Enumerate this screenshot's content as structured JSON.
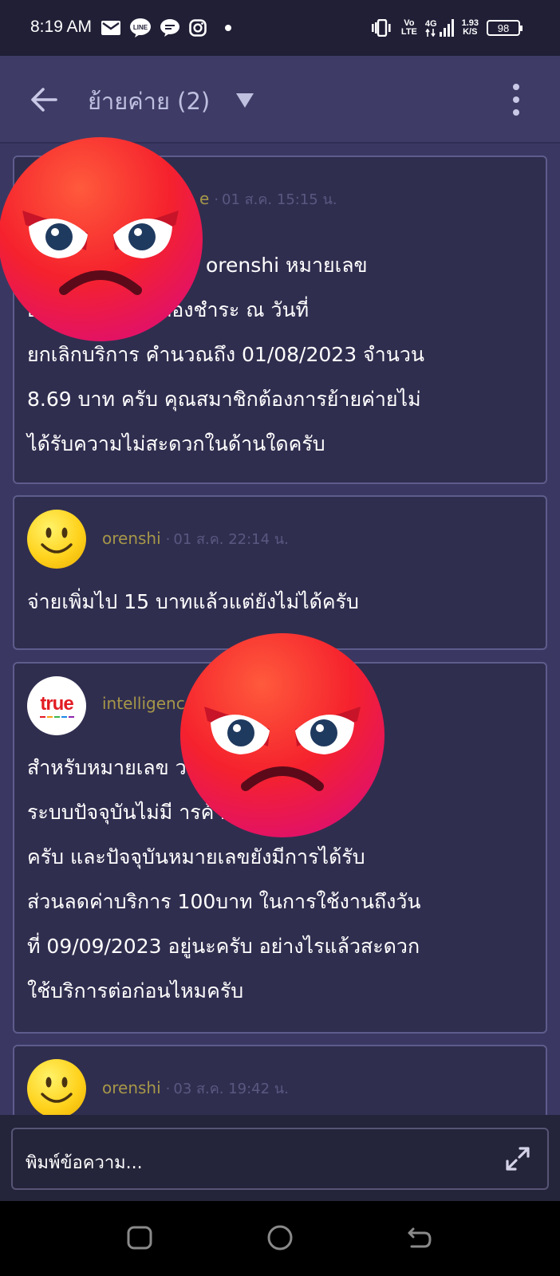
{
  "status_bar": {
    "time": "8:19 AM",
    "network_volte_top": "Vo",
    "network_volte_bottom": "LTE",
    "network_4g": "4G",
    "speed_value": "1.93",
    "speed_unit": "K/S",
    "battery": "98",
    "icons": [
      "gmail-icon",
      "line-icon",
      "chat-bubble-icon",
      "instagram-icon",
      "dot-icon",
      "vibrate-icon",
      "signal-icon",
      "battery-icon"
    ]
  },
  "header": {
    "title": "ย้ายค่าย (2)",
    "icons": [
      "back-arrow-icon",
      "dropdown-triangle-icon",
      "more-vert-icon"
    ]
  },
  "messages": [
    {
      "author": "intelligence",
      "time": "01 ส.ค. 15:15 น.",
      "text": "orenshi หมายเลข\nยอดค่าบริการที่ต้องชำระ ณ วันที่\nยกเลิกบริการ คำนวณถึง 01/08/2023 จำนวน\n8.69 บาท ครับ คุณสมาชิกต้องการย้ายค่ายไม่\nได้รับความไม่สะดวกในด้านใดครับ"
    },
    {
      "author": "orenshi",
      "time": "01 ส.ค. 22:14 น.",
      "text": "จ่ายเพิ่มไป 15 บาทแล้วแต่ยังไม่ได้ครับ"
    },
    {
      "author": "intelligence",
      "logo_text": "true",
      "time": "",
      "text": "สำหรับหมายเลข                         วจสอบใน\nระบบปัจจุบันไม่มี                        ารค้างชำระแล้ว\nครับ   และปัจจุบันหมายเลขยังมีการได้รับ\nส่วนลดค่าบริการ 100บาท ในการใช้งานถึงวัน\nที่  09/09/2023 อยู่นะครับ อย่างไรแล้วสะดวก\nใช้บริการต่อก่อนไหมครับ"
    },
    {
      "author": "orenshi",
      "time": "03 ส.ค. 19:42 น.",
      "text": ""
    }
  ],
  "author_1_visible": "e",
  "author_3_visible": "intelligenc",
  "overlays": [
    "angry-face-emoji",
    "angry-face-emoji"
  ],
  "composer": {
    "placeholder": "พิมพ์ข้อความ..."
  },
  "colors": {
    "background": "#3a3862",
    "card": "#302e4f",
    "card_border": "#5e5c8c",
    "author": "#a69748",
    "status_bar": "#201f36"
  }
}
